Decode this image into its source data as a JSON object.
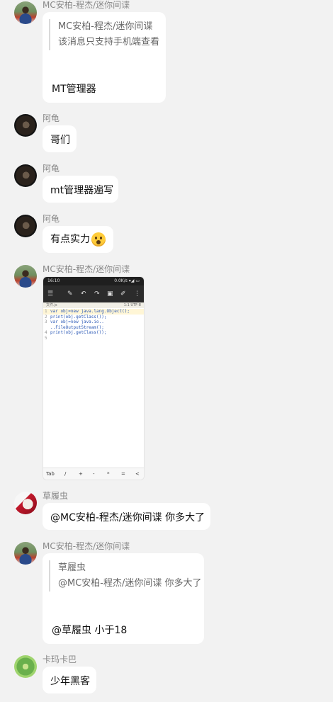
{
  "messages": [
    {
      "sender": "MC安柏-程杰/迷你间谍",
      "quote_line1": "MC安柏-程杰/迷你间谍",
      "quote_line2": "该消息只支持手机端查看",
      "text": "MT管理器"
    },
    {
      "sender": "阿龟",
      "text": "哥们"
    },
    {
      "sender": "阿龟",
      "text": "mt管理器遍写"
    },
    {
      "sender": "阿龟",
      "text": "有点实力",
      "emoji": "astonished-face"
    },
    {
      "sender": "MC安柏-程杰/迷你间谍",
      "image": {
        "status_time": "16:10",
        "status_right": "0.0K/s ▾◢ ▭",
        "file_label": "文件.js",
        "file_right": "1:1  UTF-8",
        "code_lines": [
          {
            "n": "1",
            "text": "var obj=new java.lang.Object();"
          },
          {
            "n": "2",
            "text": "print(obj.getClass());"
          },
          {
            "n": "3",
            "text": "var obj=new java.io.."
          },
          {
            "n": "",
            "text": "..FileOutputStream();"
          },
          {
            "n": "4",
            "text": "print(obj.getClass());"
          },
          {
            "n": "5",
            "text": ""
          }
        ],
        "keys": [
          "Tab",
          "/",
          "+",
          "-",
          "*",
          "=",
          "<"
        ]
      }
    },
    {
      "sender": "草履虫",
      "text": "@MC安柏-程杰/迷你间谍 你多大了"
    },
    {
      "sender": "MC安柏-程杰/迷你间谍",
      "quote_line1": "草履虫",
      "quote_line2": "@MC安柏-程杰/迷你间谍 你多大了",
      "text": "@草履虫 小于18"
    },
    {
      "sender": "卡玛卡巴",
      "text": "少年黑客"
    }
  ]
}
